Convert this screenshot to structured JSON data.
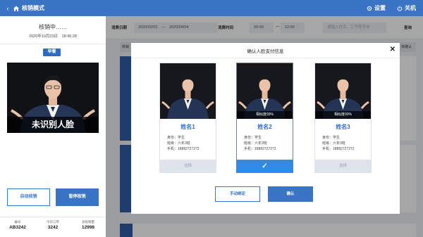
{
  "topbar": {
    "title": "核销模式",
    "settings_label": "设置",
    "shutdown_label": "关机"
  },
  "left": {
    "status": "核销中……",
    "datetime": "2020年10月23日　18:46:28",
    "meal": "早餐",
    "unrecognized": "未识别人脸",
    "auto_button": "自动核销",
    "pause_button": "暂停核销",
    "stats": [
      {
        "label": "编号",
        "value": "AB3242"
      },
      {
        "label": "今日订单",
        "value": "3242"
      },
      {
        "label": "总核销量",
        "value": "12998"
      }
    ]
  },
  "filter": {
    "date_label": "消费日期",
    "date_range": "2020/02/02　—　2020/04/04",
    "time_label": "消费时间",
    "time_start": "20:00",
    "time_dash": "—",
    "time_end": "12:00",
    "search_placeholder": "请输入姓名、工号等查询",
    "query_button": "查询"
  },
  "list": {
    "header_left": "核销",
    "header_right": "核确认"
  },
  "modal": {
    "title": "确认人脸支付信息",
    "candidates": [
      {
        "name": "姓名1",
        "similarity": "",
        "identity": "身份：学生",
        "class": "班级：六年3班",
        "phone": "手机：18882727272",
        "pick": "选择",
        "selected": false
      },
      {
        "name": "姓名2",
        "similarity": "相似度99%",
        "identity": "身份：学生",
        "class": "班级：六年3班",
        "phone": "手机：18882727272",
        "pick": "✓",
        "selected": true
      },
      {
        "name": "姓名3",
        "similarity": "相似度90%",
        "identity": "身份：学生",
        "class": "班级：六年3班",
        "phone": "手机：18882727272",
        "pick": "选择",
        "selected": false
      }
    ],
    "manual_button": "手动绑定",
    "confirm_button": "确认"
  },
  "colors": {
    "primary": "#3a74c4",
    "selected": "#2f8be6"
  }
}
